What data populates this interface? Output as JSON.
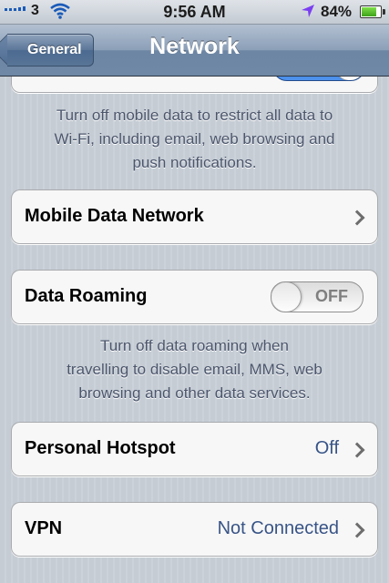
{
  "status_bar": {
    "carrier": "3",
    "time": "9:56 AM",
    "battery": "84%",
    "icons": [
      "signal-icon",
      "wifi-icon",
      "location-arrow-icon",
      "battery-icon"
    ]
  },
  "nav": {
    "back_label": "General",
    "title": "Network"
  },
  "mobile_data": {
    "footer": [
      "Turn off mobile data to restrict all data to",
      "Wi-Fi, including email, web browsing and",
      "push notifications."
    ]
  },
  "mobile_data_network": {
    "label": "Mobile Data Network"
  },
  "data_roaming": {
    "label": "Data Roaming",
    "toggle": "OFF",
    "footer": [
      "Turn off data roaming when",
      "travelling to disable email, MMS, web",
      "browsing and other data services."
    ]
  },
  "personal_hotspot": {
    "label": "Personal Hotspot",
    "value": "Off"
  },
  "vpn": {
    "label": "VPN",
    "value": "Not Connected"
  },
  "colors": {
    "nav": "#6d86a4",
    "value_text": "#385487",
    "toggle_on": "#1f64c8"
  }
}
